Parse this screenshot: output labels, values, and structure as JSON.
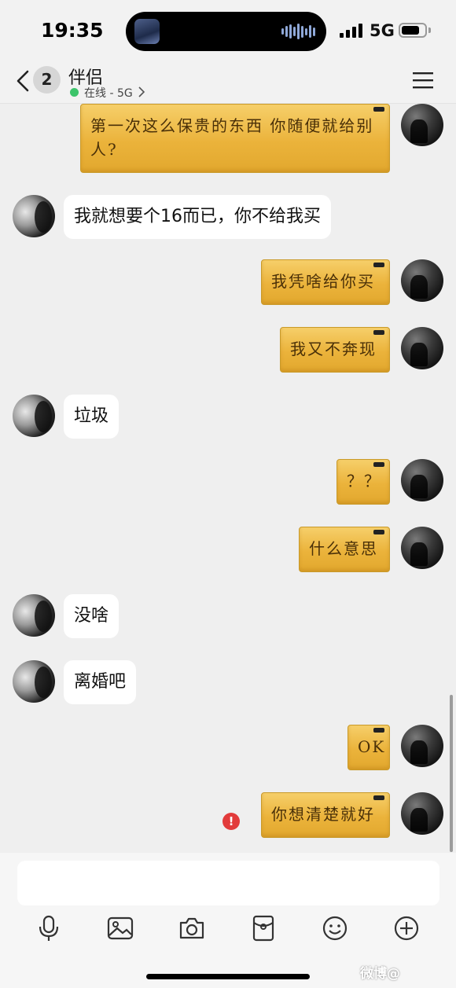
{
  "status_bar": {
    "time": "19:35",
    "network": "5G",
    "battery_level": 0.7
  },
  "header": {
    "unread_count": "2",
    "contact_name": "伴侣",
    "contact_status": "在线 - 5G",
    "online_color": "#3cc46a"
  },
  "messages": [
    {
      "side": "right",
      "text": "第一次这么保贵的东西 你随便就给别人?",
      "style": "gold-card"
    },
    {
      "side": "left",
      "text": "我就想要个16而已，你不给我买"
    },
    {
      "side": "right",
      "text": "我凭啥给你买",
      "style": "gold-card"
    },
    {
      "side": "right",
      "text": "我又不奔现",
      "style": "gold-card"
    },
    {
      "side": "left",
      "text": "垃圾"
    },
    {
      "side": "right",
      "text": "？？",
      "style": "gold-card"
    },
    {
      "side": "right",
      "text": "什么意思",
      "style": "gold-card"
    },
    {
      "side": "left",
      "text": "没啥"
    },
    {
      "side": "left",
      "text": "离婚吧"
    },
    {
      "side": "right",
      "text": "OK",
      "style": "gold-card"
    },
    {
      "side": "right",
      "text": "你想清楚就好",
      "style": "gold-card",
      "send_failed": true
    }
  ],
  "input": {
    "placeholder": "",
    "value": ""
  },
  "toolbar": [
    "microphone-icon",
    "image-icon",
    "camera-icon",
    "red-packet-icon",
    "emoji-icon",
    "plus-icon"
  ],
  "colors": {
    "bubble_gold": "#ebb33b",
    "error_red": "#e23b3b",
    "chat_bg": "#efefef"
  },
  "watermark": "微博@"
}
